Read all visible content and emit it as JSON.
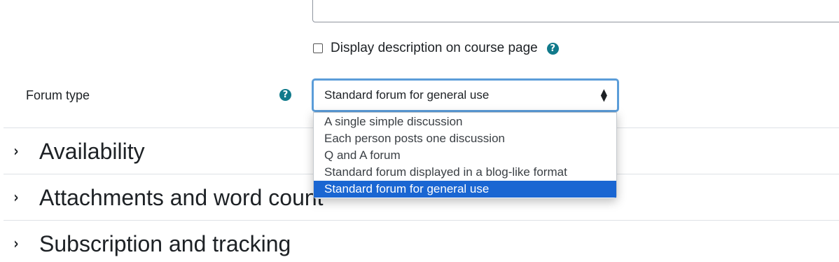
{
  "description": {
    "checkbox_label": "Display description on course page",
    "checked": false
  },
  "forum_type": {
    "label": "Forum type",
    "selected": "Standard forum for general use",
    "options": [
      "A single simple discussion",
      "Each person posts one discussion",
      "Q and A forum",
      "Standard forum displayed in a blog-like format",
      "Standard forum for general use"
    ]
  },
  "sections": [
    "Availability",
    "Attachments and word count",
    "Subscription and tracking"
  ],
  "icons": {
    "help": "?",
    "select_arrow": "▲▼",
    "section_toggle": "›"
  },
  "colors": {
    "help_icon": "#117a8b",
    "focus_border": "#5b9dd9",
    "selected_option_bg": "#1a66d2"
  }
}
